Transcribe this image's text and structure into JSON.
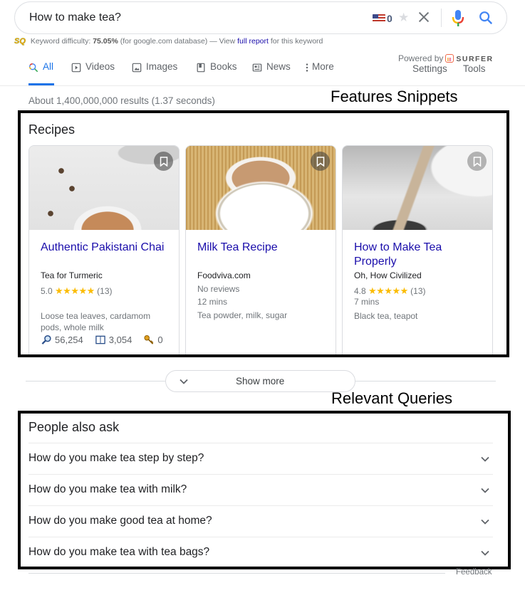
{
  "search": {
    "query": "How to make tea?",
    "flag_count": "0"
  },
  "keyword_difficulty": {
    "logo": "SQ",
    "label": "Keyword difficulty:",
    "value": "75.05%",
    "database_note": "(for google.com database) — View",
    "link_text": "full report",
    "suffix": "for this keyword"
  },
  "tabs": [
    {
      "label": "All",
      "icon": "search-icon",
      "active": true
    },
    {
      "label": "Videos",
      "icon": "play-icon"
    },
    {
      "label": "Images",
      "icon": "image-icon"
    },
    {
      "label": "Books",
      "icon": "book-icon"
    },
    {
      "label": "News",
      "icon": "news-icon"
    },
    {
      "label": "More",
      "icon": "kebab-icon"
    }
  ],
  "toolbar": {
    "powered_by": "Powered by",
    "surfer": "SURFER",
    "settings": "Settings",
    "tools": "Tools"
  },
  "result_stats": "About 1,400,000,000 results (1.37 seconds)",
  "annotations": {
    "features_snippets": "Features Snippets",
    "relevant_queries": "Relevant Queries"
  },
  "recipes": {
    "title": "Recipes",
    "cards": [
      {
        "title": "Authentic Pakistani Chai",
        "source": "Tea for Turmeric",
        "rating": "5.0",
        "stars": "★★★★★",
        "reviews": "(13)",
        "ingredients": "Loose tea leaves, cardamom pods, whole milk",
        "metrics": {
          "searches": "56,254",
          "pages": "3,054",
          "keys": "0"
        }
      },
      {
        "title": "Milk Tea Recipe",
        "source": "Foodviva.com",
        "reviews_text": "No reviews",
        "time": "12 mins",
        "ingredients": "Tea powder, milk, sugar"
      },
      {
        "title": "How to Make Tea Properly",
        "source": "Oh, How Civilized",
        "rating": "4.8",
        "stars": "★★★★★",
        "reviews": "(13)",
        "time": "7 mins",
        "ingredients": "Black tea, teapot"
      }
    ],
    "show_more": "Show more"
  },
  "people_also_ask": {
    "title": "People also ask",
    "questions": [
      "How do you make tea step by step?",
      "How do you make tea with milk?",
      "How do you make good tea at home?",
      "How do you make tea with tea bags?"
    ],
    "feedback": "Feedback"
  },
  "colors": {
    "link": "#1a0dab",
    "accent": "#1a73e8",
    "star": "#fbbc04",
    "muted": "#70757a"
  }
}
